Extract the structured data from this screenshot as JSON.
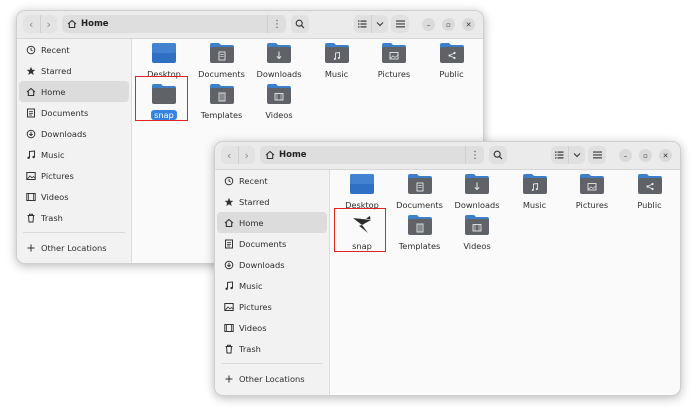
{
  "windows": [
    {
      "location": "Home",
      "sidebar": [
        {
          "label": "Recent",
          "icon": "recent-icon"
        },
        {
          "label": "Starred",
          "icon": "star-icon"
        },
        {
          "label": "Home",
          "icon": "home-icon",
          "active": true
        },
        {
          "label": "Documents",
          "icon": "documents-icon"
        },
        {
          "label": "Downloads",
          "icon": "downloads-icon"
        },
        {
          "label": "Music",
          "icon": "music-icon"
        },
        {
          "label": "Pictures",
          "icon": "pictures-icon"
        },
        {
          "label": "Videos",
          "icon": "videos-icon"
        },
        {
          "label": "Trash",
          "icon": "trash-icon"
        }
      ],
      "other_locations": "Other Locations",
      "files": [
        "Desktop",
        "Documents",
        "Downloads",
        "Music",
        "Pictures",
        "Public",
        "snap",
        "Templates",
        "Videos"
      ],
      "selected_file": "snap"
    },
    {
      "location": "Home",
      "sidebar": [
        {
          "label": "Recent",
          "icon": "recent-icon"
        },
        {
          "label": "Starred",
          "icon": "star-icon"
        },
        {
          "label": "Home",
          "icon": "home-icon",
          "active": true
        },
        {
          "label": "Documents",
          "icon": "documents-icon"
        },
        {
          "label": "Downloads",
          "icon": "downloads-icon"
        },
        {
          "label": "Music",
          "icon": "music-icon"
        },
        {
          "label": "Pictures",
          "icon": "pictures-icon"
        },
        {
          "label": "Videos",
          "icon": "videos-icon"
        },
        {
          "label": "Trash",
          "icon": "trash-icon"
        }
      ],
      "other_locations": "Other Locations",
      "files": [
        "Desktop",
        "Documents",
        "Downloads",
        "Music",
        "Pictures",
        "Public",
        "snap",
        "Templates",
        "Videos"
      ],
      "snap_icon": "snapcraft-icon"
    }
  ],
  "colors": {
    "folder_body": "#5f6368",
    "folder_tab": "#3d7fc8",
    "desktop_blue": "#2f6fc4",
    "selection": "#3584e4",
    "highlight": "#e02424"
  }
}
